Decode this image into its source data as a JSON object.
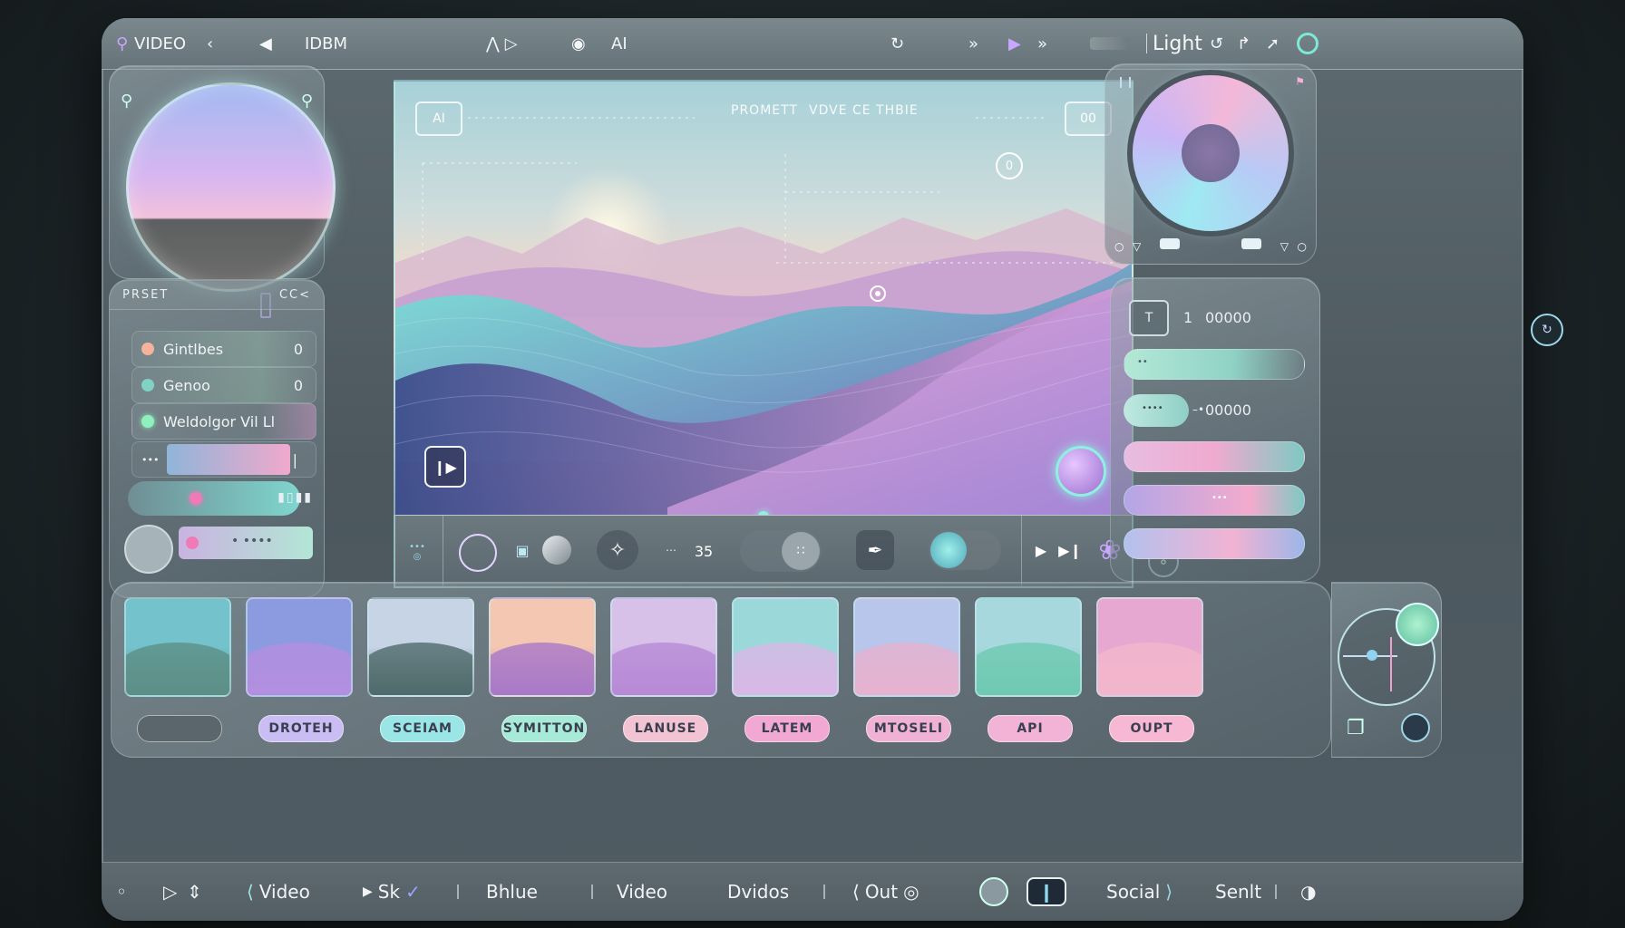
{
  "topbar": {
    "video_label": "VIDEO",
    "mode_label": "IDBM",
    "ai_label": "AI",
    "theme_label": "Light"
  },
  "left": {
    "preset_label": "PRSET",
    "preset_action": "CC<",
    "rows": [
      {
        "label": "Gintlbes",
        "value": "0",
        "dot": "#f6b39c"
      },
      {
        "label": "Genoo",
        "value": "0",
        "dot": "#7fd2c4"
      },
      {
        "label": "Weldolgor Vil Ll",
        "value": "",
        "dot": "#8ff0bd"
      }
    ],
    "slider_level": 0.72
  },
  "viewport": {
    "ai_badge": "AI",
    "prompt_label": "PROMETT",
    "mode_text": "VDVE CE THBIE",
    "counter": "00",
    "node_label": "0",
    "scrub_position": 0.5
  },
  "controls": {
    "frame_value": "35"
  },
  "right": {
    "row1_index": "1",
    "row1_value": "00000",
    "row2_value": "00000"
  },
  "thumbs": [
    {
      "name": "lake-dawn",
      "sky": "#73c2cc",
      "ground": "#5d8f86"
    },
    {
      "name": "violet-lake",
      "sky": "#8c9be0",
      "ground": "#b38ee0"
    },
    {
      "name": "mountain",
      "sky": "#c6d4e6",
      "ground": "#4f6a6a"
    },
    {
      "name": "sunset-hills",
      "sky": "#f3c7b2",
      "ground": "#a978c8"
    },
    {
      "name": "lavender-field",
      "sky": "#d8c1e8",
      "ground": "#b68ad6"
    },
    {
      "name": "cactus",
      "sky": "#9ad8d9",
      "ground": "#d9b8e6"
    },
    {
      "name": "misty-sea",
      "sky": "#b7c6ea",
      "ground": "#e6b2cf"
    },
    {
      "name": "green-valley",
      "sky": "#a7d8dd",
      "ground": "#6fc9b2"
    },
    {
      "name": "pink-horizon",
      "sky": "#e6a8d1",
      "ground": "#f2b6cc"
    }
  ],
  "tags": [
    {
      "label": "",
      "color": "#5a666c"
    },
    {
      "label": "DROTEH",
      "color": "#c9bdf3"
    },
    {
      "label": "SCEIAM",
      "color": "#9ae6e6"
    },
    {
      "label": "SYMITTON",
      "color": "#a7ead7"
    },
    {
      "label": "LANUSE",
      "color": "#f2c3d2"
    },
    {
      "label": "LATEM",
      "color": "#f1a9d4"
    },
    {
      "label": "MTOSELI",
      "color": "#f0b2d4"
    },
    {
      "label": "API",
      "color": "#f3b3d6"
    },
    {
      "label": "OUPT",
      "color": "#f6b8d2"
    }
  ],
  "bottom": {
    "video1": "Video",
    "sk": "Sk",
    "bhlue": "Bhlue",
    "video2": "Video",
    "dvidos": "Dvidos",
    "out": "Out",
    "social": "Social",
    "senlt": "Senlt"
  }
}
